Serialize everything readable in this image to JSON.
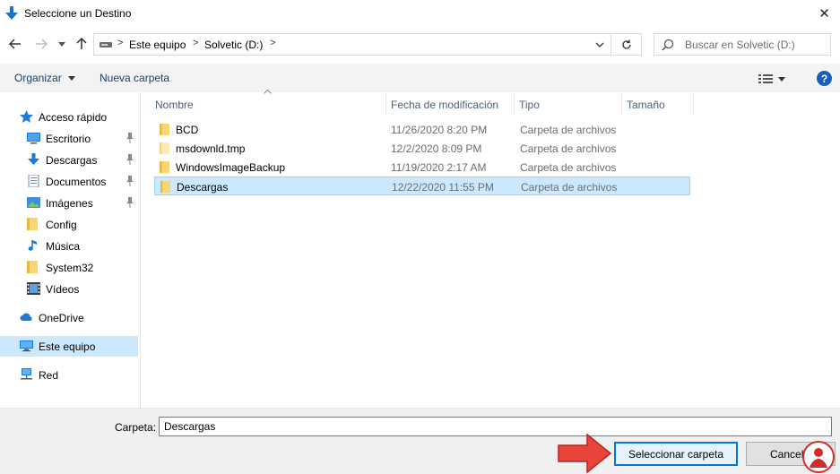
{
  "window": {
    "title": "Seleccione un Destino",
    "close_glyph": "✕"
  },
  "address": {
    "breadcrumbs": [
      "Este equipo",
      "Solvetic (D:)"
    ],
    "separator": ">"
  },
  "search": {
    "placeholder": "Buscar en Solvetic (D:)"
  },
  "toolbar": {
    "organize_label": "Organizar",
    "new_folder_label": "Nueva carpeta",
    "help_label": "?"
  },
  "nav": {
    "quick_access": {
      "label": "Acceso rápido",
      "icon": "star-icon"
    },
    "items": [
      {
        "label": "Escritorio",
        "icon": "desktop-icon",
        "pinned": true
      },
      {
        "label": "Descargas",
        "icon": "download-icon",
        "pinned": true
      },
      {
        "label": "Documentos",
        "icon": "documents-icon",
        "pinned": true
      },
      {
        "label": "Imágenes",
        "icon": "pictures-icon",
        "pinned": true
      },
      {
        "label": "Config",
        "icon": "folder-icon",
        "pinned": false
      },
      {
        "label": "Música",
        "icon": "music-icon",
        "pinned": false
      },
      {
        "label": "System32",
        "icon": "folder-icon",
        "pinned": false
      },
      {
        "label": "Vídeos",
        "icon": "videos-icon",
        "pinned": false
      }
    ],
    "onedrive": {
      "label": "OneDrive",
      "icon": "cloud-icon"
    },
    "this_pc": {
      "label": "Este equipo",
      "icon": "computer-icon",
      "selected": true
    },
    "network": {
      "label": "Red",
      "icon": "network-icon"
    }
  },
  "columns": [
    "Nombre",
    "Fecha de modificación",
    "Tipo",
    "Tamaño"
  ],
  "files": [
    {
      "name": "BCD",
      "date": "11/26/2020 8:20 PM",
      "type": "Carpeta de archivos",
      "icon": "folder-icon",
      "selected": false
    },
    {
      "name": "msdownld.tmp",
      "date": "12/2/2020 8:09 PM",
      "type": "Carpeta de archivos",
      "icon": "folder-hidden-icon",
      "selected": false
    },
    {
      "name": "WindowsImageBackup",
      "date": "11/19/2020 2:17 AM",
      "type": "Carpeta de archivos",
      "icon": "folder-icon",
      "selected": false
    },
    {
      "name": "Descargas",
      "date": "12/22/2020 11:55 PM",
      "type": "Carpeta de archivos",
      "icon": "folder-icon",
      "selected": true
    }
  ],
  "bottom": {
    "folder_label": "Carpeta:",
    "folder_value": "Descargas",
    "select_label": "Seleccionar carpeta",
    "cancel_label": "Cancelar"
  },
  "colors": {
    "accent": "#0078d7",
    "selection": "#cce8ff",
    "folder": "#f7d774",
    "arrow": "#e8443a"
  }
}
